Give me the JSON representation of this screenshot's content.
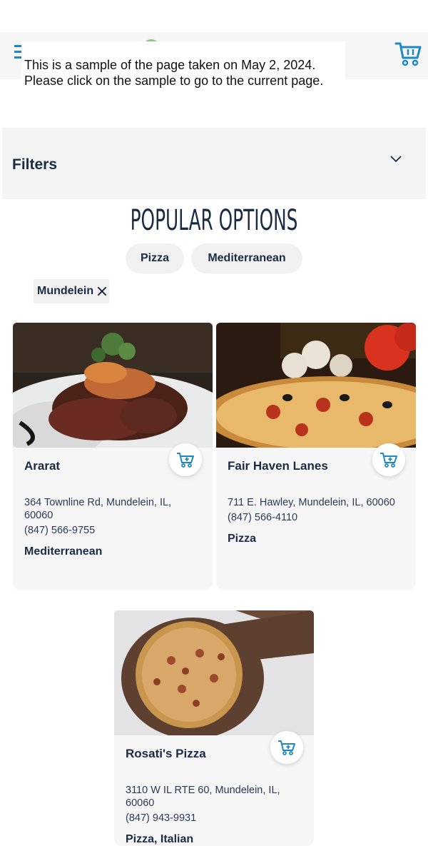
{
  "header": {
    "menu_icon": "hamburger-menu-icon",
    "cart_icon": "shopping-cart-icon"
  },
  "notice": {
    "line1": "This is a sample of the page taken on May 2, 2024.",
    "line2": "Please click on the sample to go to the current page."
  },
  "filters": {
    "label": "Filters",
    "chevron_icon": "chevron-down-icon"
  },
  "popular": {
    "title": "POPULAR OPTIONS",
    "options": [
      "Pizza",
      "Mediterranean"
    ]
  },
  "active_filter": {
    "label": "Mundelein",
    "remove_icon": "close-icon"
  },
  "restaurants": [
    {
      "name": "Ararat",
      "address": "364 Townline Rd, Mundelein, IL, 60060",
      "phone": "(847) 566-9755",
      "cuisine": "Mediterranean"
    },
    {
      "name": "Fair Haven Lanes",
      "address": "711 E. Hawley, Mundelein, IL, 60060",
      "phone": "(847) 566-4110",
      "cuisine": "Pizza"
    },
    {
      "name": "Rosati's Pizza",
      "address": "3110 W IL RTE 60, Mundelein, IL, 60060",
      "phone": "(847) 943-9931",
      "cuisine": "Pizza, Italian"
    }
  ],
  "colors": {
    "accent": "#1e88c7",
    "text": "#1b2b44",
    "panel": "#f4f4f4"
  }
}
